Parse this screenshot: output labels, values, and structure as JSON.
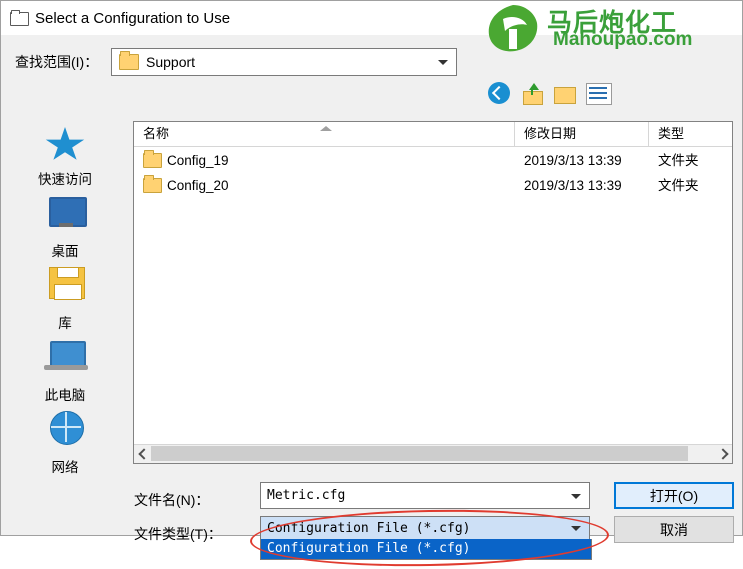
{
  "window": {
    "title": "Select a Configuration to Use",
    "icon": "folder-icon"
  },
  "lookin": {
    "label": "查找范围(I)：",
    "value": "Support"
  },
  "toolbar": {
    "back": "back-icon",
    "up": "up-one-level-icon",
    "new_folder": "new-folder-icon",
    "views": "views-icon"
  },
  "places": [
    {
      "label": "快速访问",
      "icon": "star-icon"
    },
    {
      "label": "桌面",
      "icon": "desktop-icon"
    },
    {
      "label": "库",
      "icon": "library-icon"
    },
    {
      "label": "此电脑",
      "icon": "computer-icon"
    },
    {
      "label": "网络",
      "icon": "network-icon"
    }
  ],
  "filelist": {
    "columns": [
      "名称",
      "修改日期",
      "类型"
    ],
    "rows": [
      {
        "name": "Config_19",
        "date": "2019/3/13 13:39",
        "type": "文件夹"
      },
      {
        "name": "Config_20",
        "date": "2019/3/13 13:39",
        "type": "文件夹"
      }
    ]
  },
  "fields": {
    "filename_label": "文件名(N)：",
    "filename_value": "Metric.cfg",
    "filetype_label": "文件类型(T)：",
    "filetype_value": "Configuration File (*.cfg)",
    "filetype_option": "Configuration File (*.cfg)"
  },
  "buttons": {
    "open": "打开(O)",
    "cancel": "取消"
  },
  "watermark": {
    "cn": "马后炮化工",
    "en": "Mahoupao.com"
  },
  "colors": {
    "accent": "#0078d7",
    "highlight": "#0a64c8",
    "annotation": "#e03b2f",
    "watermark": "#3aa03a"
  }
}
